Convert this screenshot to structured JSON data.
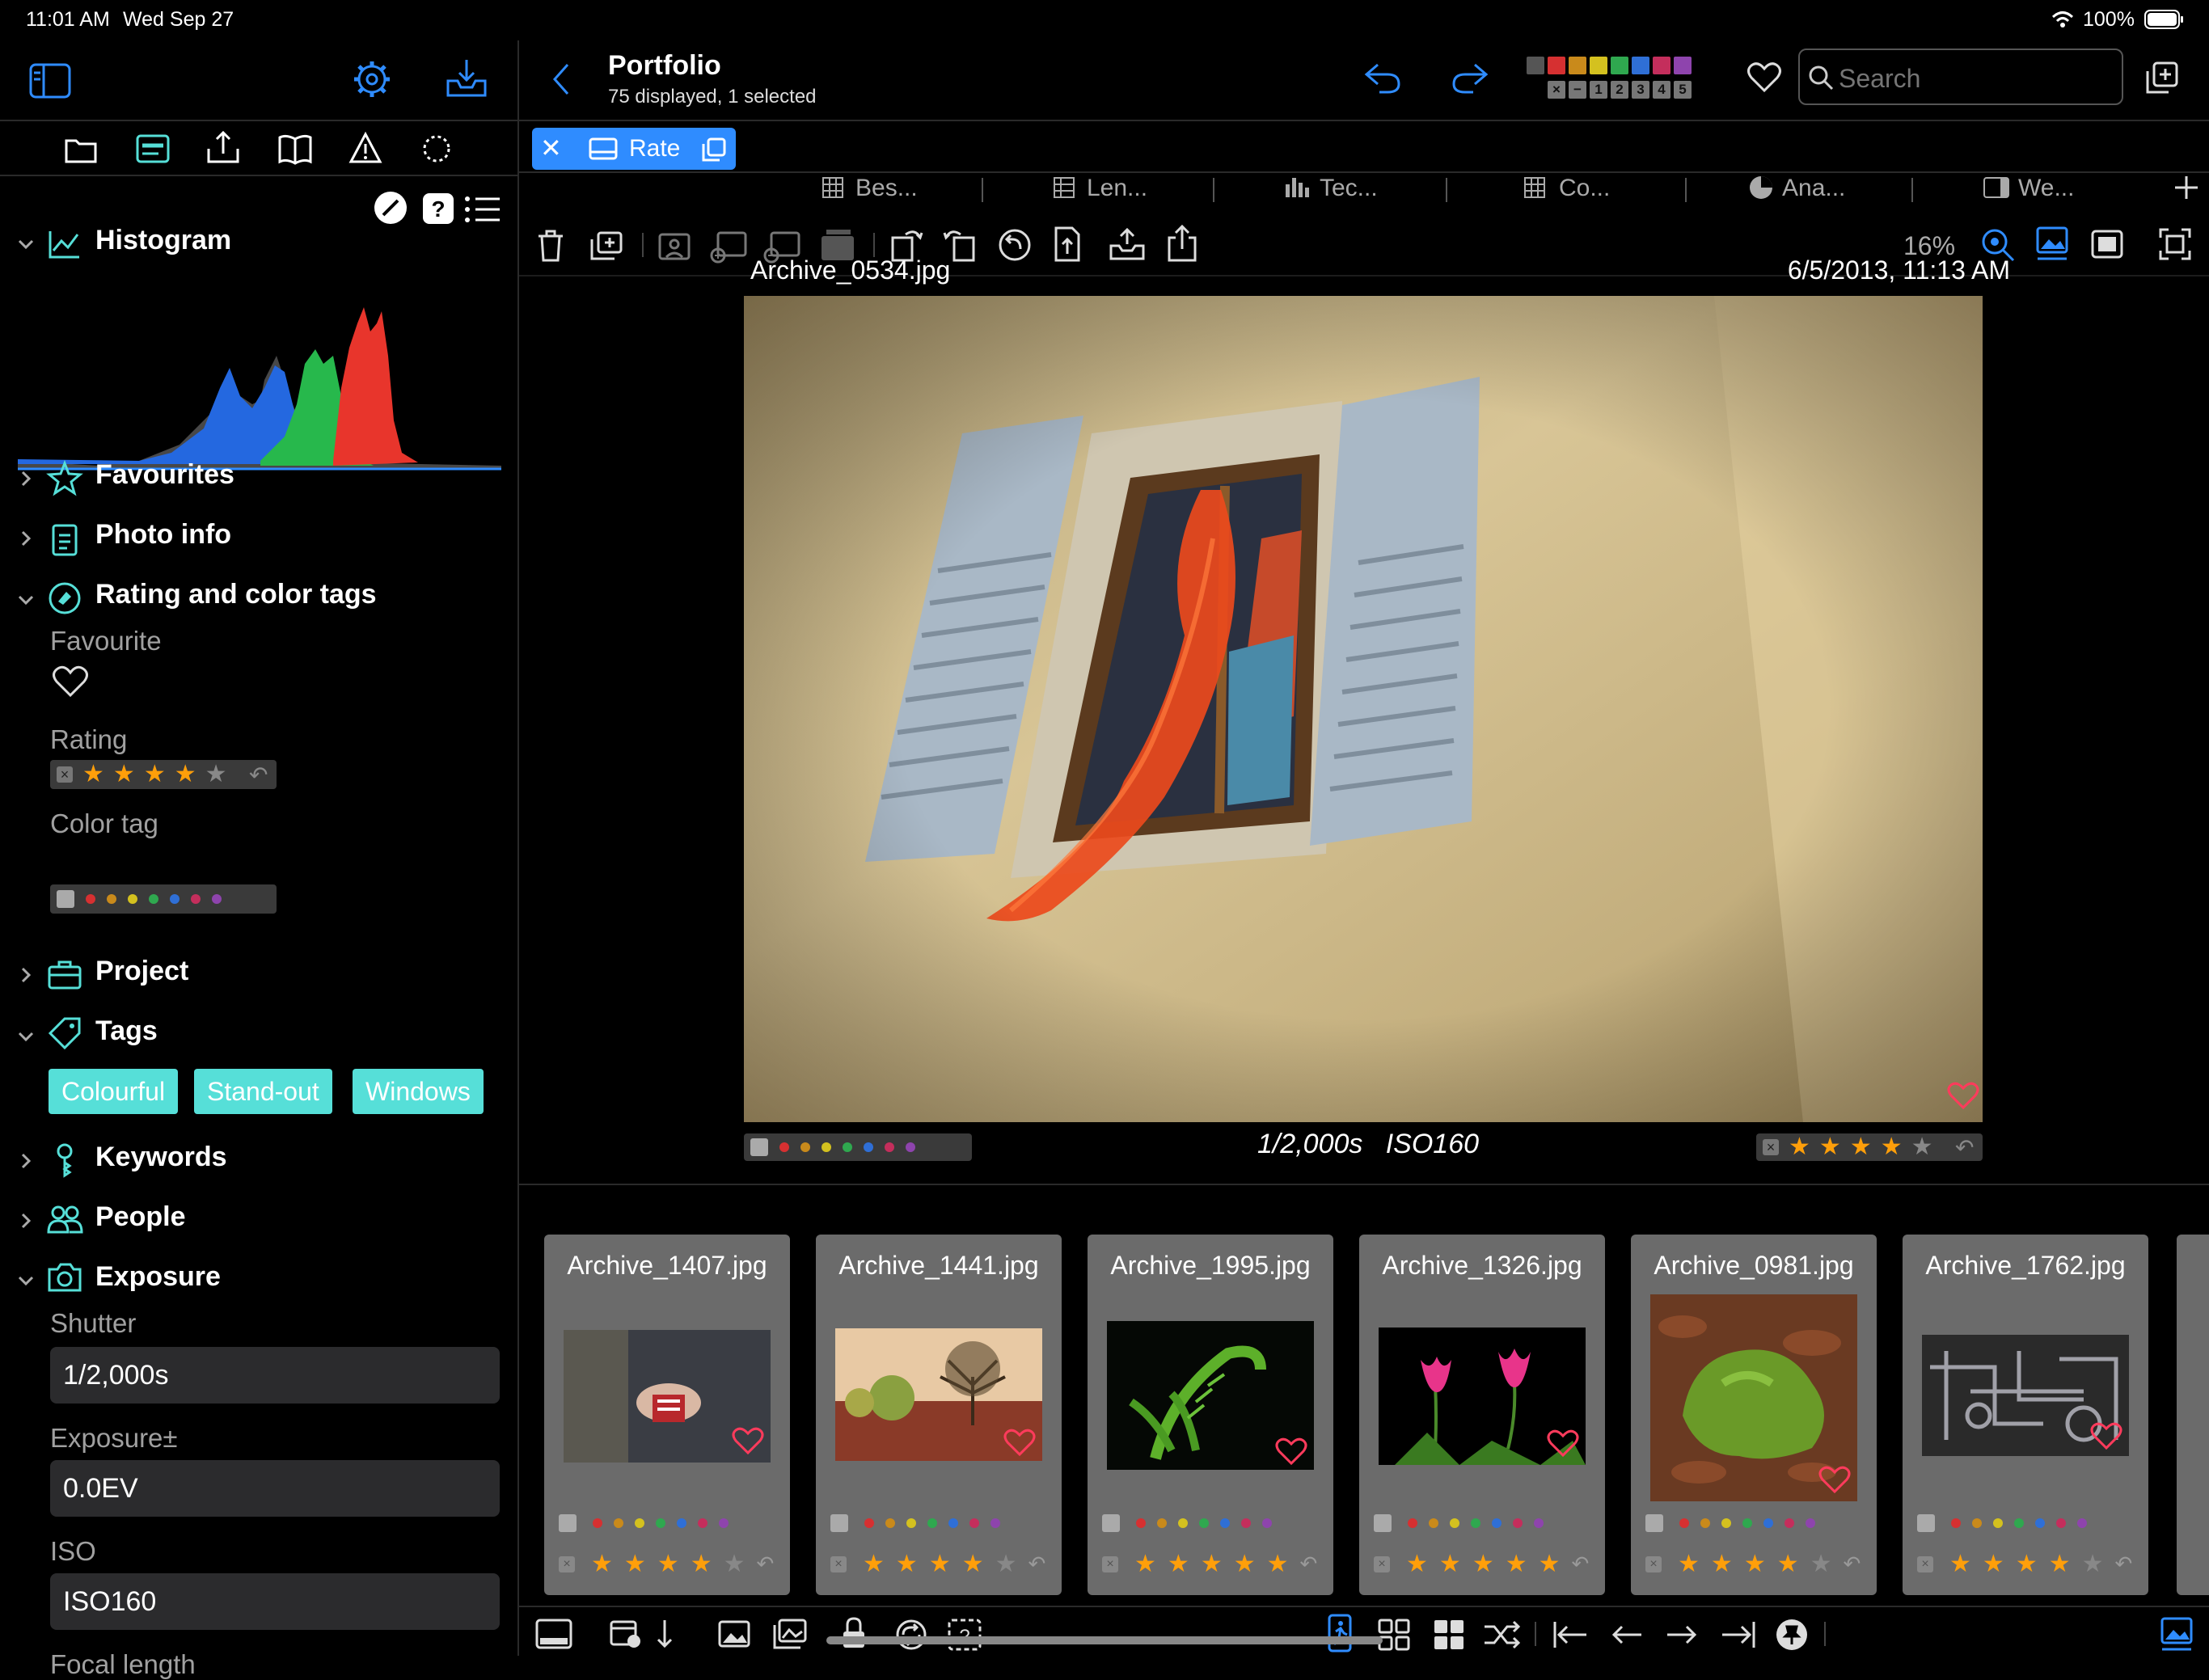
{
  "status": {
    "time": "11:01 AM",
    "date": "Wed Sep 27",
    "battery": "100%"
  },
  "header": {
    "title": "Portfolio",
    "subtitle": "75 displayed, 1 selected",
    "search_placeholder": "Search",
    "filter_numbers": [
      "×",
      "−",
      "1",
      "2",
      "3",
      "4",
      "5"
    ]
  },
  "colors": {
    "accent": "#2f8cff",
    "star": "#ff9f0a",
    "tag": "#56dfd8",
    "heart": "#ff3b5c"
  },
  "tag_palette": [
    "#d63031",
    "#c98a1b",
    "#d4c11f",
    "#2fa84f",
    "#2f6fd6",
    "#c42e5c",
    "#8e44ad"
  ],
  "tabs": [
    {
      "label": "Rate",
      "active": true
    },
    {
      "label": "Bes..."
    },
    {
      "label": "Len..."
    },
    {
      "label": "Tec..."
    },
    {
      "label": "Co..."
    },
    {
      "label": "Ana..."
    },
    {
      "label": "We..."
    }
  ],
  "toolbar": {
    "zoom": "16%"
  },
  "viewer": {
    "filename": "Archive_0534.jpg",
    "datetime": "6/5/2013, 11:13 AM",
    "exposure_info": "1/2,000s   ISO160",
    "rating": 4,
    "favourite": false
  },
  "sidebar": {
    "sections": {
      "histogram": "Histogram",
      "favourites": "Favourites",
      "photo_info": "Photo info",
      "rating_color": "Rating and color tags",
      "project": "Project",
      "tags": "Tags",
      "keywords": "Keywords",
      "people": "People",
      "exposure": "Exposure"
    },
    "favourite_label": "Favourite",
    "rating_label": "Rating",
    "rating_value": 4,
    "color_tag_label": "Color tag",
    "tags": [
      "Colourful",
      "Stand-out",
      "Windows"
    ],
    "exposure": {
      "shutter_label": "Shutter",
      "shutter_value": "1/2,000s",
      "ev_label": "Exposure±",
      "ev_value": "0.0EV",
      "iso_label": "ISO",
      "iso_value": "ISO160",
      "focal_label": "Focal length"
    }
  },
  "filmstrip": [
    {
      "name": "Archive_1407.jpg",
      "rating": 4
    },
    {
      "name": "Archive_1441.jpg",
      "rating": 4
    },
    {
      "name": "Archive_1995.jpg",
      "rating": 5
    },
    {
      "name": "Archive_1326.jpg",
      "rating": 5
    },
    {
      "name": "Archive_0981.jpg",
      "rating": 4
    },
    {
      "name": "Archive_1762.jpg",
      "rating": 4
    }
  ]
}
